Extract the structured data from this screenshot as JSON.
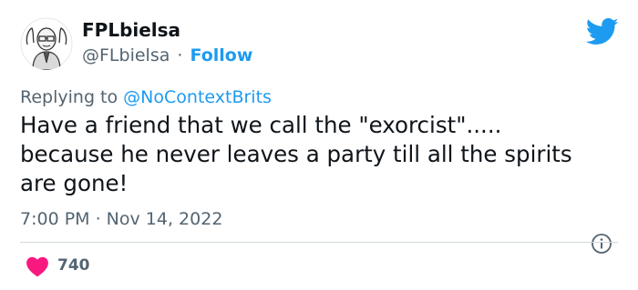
{
  "author": {
    "display_name": "FPLbielsa",
    "handle": "@FLbielsa",
    "separator": "·",
    "follow_label": "Follow"
  },
  "reply": {
    "prefix": "Replying to",
    "mention": "@NoContextBrits"
  },
  "tweet": {
    "lines": [
      "Have a friend that we call the \"exorcist\".....",
      "because he never leaves a party till all the spirits",
      "are gone!"
    ],
    "timestamp": "7:00 PM · Nov 14, 2022"
  },
  "engagement": {
    "likes": "740"
  },
  "colors": {
    "accent": "#1d9bf0",
    "like": "#f91880",
    "muted": "#536471",
    "text": "#0f1419"
  },
  "icons": {
    "brand": "twitter-bird-icon",
    "info": "info-icon",
    "like": "heart-icon"
  }
}
